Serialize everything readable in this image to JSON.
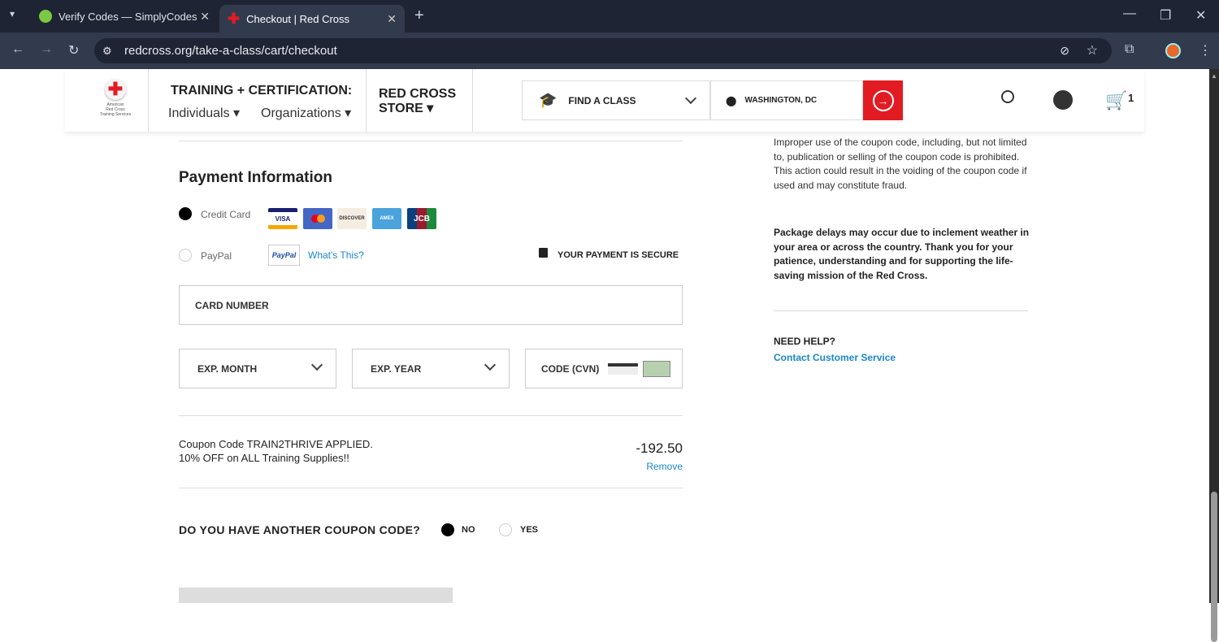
{
  "browser": {
    "tabs": [
      {
        "title": "Verify Codes — SimplyCodes"
      },
      {
        "title": "Checkout | Red Cross"
      }
    ],
    "url": "redcross.org/take-a-class/cart/checkout"
  },
  "header": {
    "logo_text": "American Red Cross Training Services",
    "training_title": "TRAINING + CERTIFICATION:",
    "individuals": "Individuals",
    "organizations": "Organizations",
    "store_line1": "RED CROSS",
    "store_line2": "STORE",
    "find_class": "FIND A CLASS",
    "location": "WASHINGTON, DC",
    "cart_count": "1"
  },
  "payment": {
    "title": "Payment Information",
    "credit_card": "Credit Card",
    "cards": [
      "VISA",
      "MC",
      "DISCOVER",
      "AMEX",
      "JCB"
    ],
    "paypal": "PayPal",
    "paypal_logo": "PayPal",
    "whats_this": "What's This?",
    "secure": "YOUR PAYMENT IS SECURE",
    "card_number": "CARD NUMBER",
    "exp_month": "EXP. MONTH",
    "exp_year": "EXP. YEAR",
    "cvn": "CODE (CVN)"
  },
  "coupon": {
    "applied": "Coupon Code TRAIN2THRIVE APPLIED.",
    "desc": "10% OFF on ALL Training Supplies!!",
    "amount": "-192.50",
    "remove": "Remove",
    "another_q": "DO YOU HAVE ANOTHER COUPON CODE?",
    "no": "NO",
    "yes": "YES"
  },
  "sidebar": {
    "notice": "Improper use of the coupon code, including, but not limited to, publication or selling of the coupon code is prohibited. This action could result in the voiding of the coupon code if used and may constitute fraud.",
    "delays": "Package delays may occur due to inclement weather in your area or across the country. Thank you for your patience, understanding and for supporting the life-saving mission of the Red Cross.",
    "help_title": "NEED HELP?",
    "contact": "Contact Customer Service"
  }
}
